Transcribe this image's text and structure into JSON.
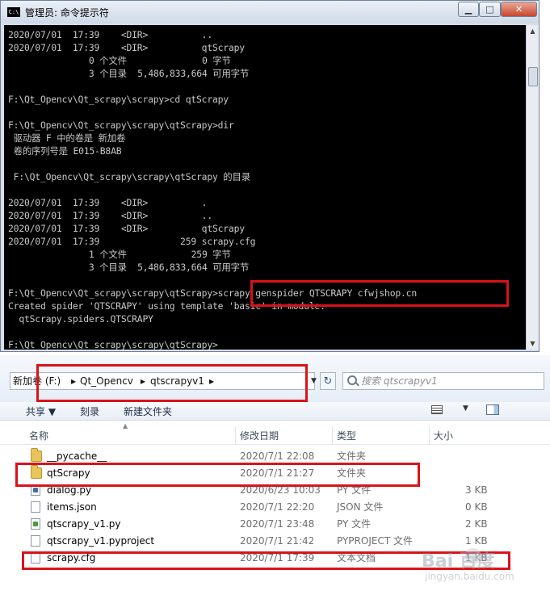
{
  "cmd_window": {
    "title": "管理员: 命令提示符",
    "icon_label": "C:\\",
    "controls": {
      "minimize": "▁",
      "maximize": "□",
      "close": "✕"
    },
    "lines": [
      "2020/07/01  17:39    <DIR>          ..",
      "2020/07/01  17:39    <DIR>          qtScrapy",
      "               0 个文件              0 字节",
      "               3 个目录  5,486,833,664 可用字节",
      "",
      "F:\\Qt_Opencv\\Qt_scrapy\\scrapy>cd qtScrapy",
      "",
      "F:\\Qt_Opencv\\Qt_scrapy\\scrapy\\qtScrapy>dir",
      " 驱动器 F 中的卷是 新加卷",
      " 卷的序列号是 E015-B8AB",
      "",
      " F:\\Qt_Opencv\\Qt_scrapy\\scrapy\\qtScrapy 的目录",
      "",
      "2020/07/01  17:39    <DIR>          .",
      "2020/07/01  17:39    <DIR>          ..",
      "2020/07/01  17:39    <DIR>          qtScrapy",
      "2020/07/01  17:39               259 scrapy.cfg",
      "               1 个文件            259 字节",
      "               3 个目录  5,486,833,664 可用字节",
      "",
      "F:\\Qt_Opencv\\Qt_scrapy\\scrapy\\qtScrapy>scrapy genspider QTSCRAPY cfwjshop.cn",
      "Created spider 'QTSCRAPY' using template 'basic' in module:",
      "  qtScrapy.spiders.QTSCRAPY",
      "",
      "F:\\Qt_Opencv\\Qt_scrapy\\scrapy\\qtScrapy>"
    ]
  },
  "explorer": {
    "address": {
      "root": "新加卷 (F:)",
      "sep": "▸",
      "crumb1": "Qt_Opencv",
      "crumb2": "qtscrapyv1",
      "dropdown": "▼"
    },
    "refresh_glyph": "↻",
    "search_placeholder": "搜索 qtscrapyv1",
    "toolbar": {
      "share": "共享 ▼",
      "burn": "刻录",
      "new_folder": "新建文件夹",
      "view_arrow": "▼"
    },
    "columns": {
      "name": "名称",
      "date": "修改日期",
      "type": "类型",
      "size": "大小"
    },
    "files": [
      {
        "name": "__pycache__",
        "date": "2020/7/1 22:08",
        "type": "文件夹",
        "size": "",
        "icon": "folder-icon"
      },
      {
        "name": "qtScrapy",
        "date": "2020/7/1 21:27",
        "type": "文件夹",
        "size": "",
        "icon": "folder-icon"
      },
      {
        "name": "dialog.py",
        "date": "2020/6/23 10:03",
        "type": "PY 文件",
        "size": "3 KB",
        "icon": "python-file-icon"
      },
      {
        "name": "items.json",
        "date": "2020/7/1 22:20",
        "type": "JSON 文件",
        "size": "0 KB",
        "icon": "document-icon"
      },
      {
        "name": "qtscrapy_v1.py",
        "date": "2020/7/1 23:48",
        "type": "PY 文件",
        "size": "2 KB",
        "icon": "python-file-icon"
      },
      {
        "name": "qtscrapy_v1.pyproject",
        "date": "2020/7/1 21:42",
        "type": "PYPROJECT 文件",
        "size": "1 KB",
        "icon": "document-icon"
      },
      {
        "name": "scrapy.cfg",
        "date": "2020/7/1 17:39",
        "type": "文本文档",
        "size": "1 KB",
        "icon": "document-icon"
      }
    ]
  },
  "annotation_color": "#d9131a",
  "watermark": {
    "logo": "Bai 百度",
    "sub": "jingyan.baidu.com"
  }
}
